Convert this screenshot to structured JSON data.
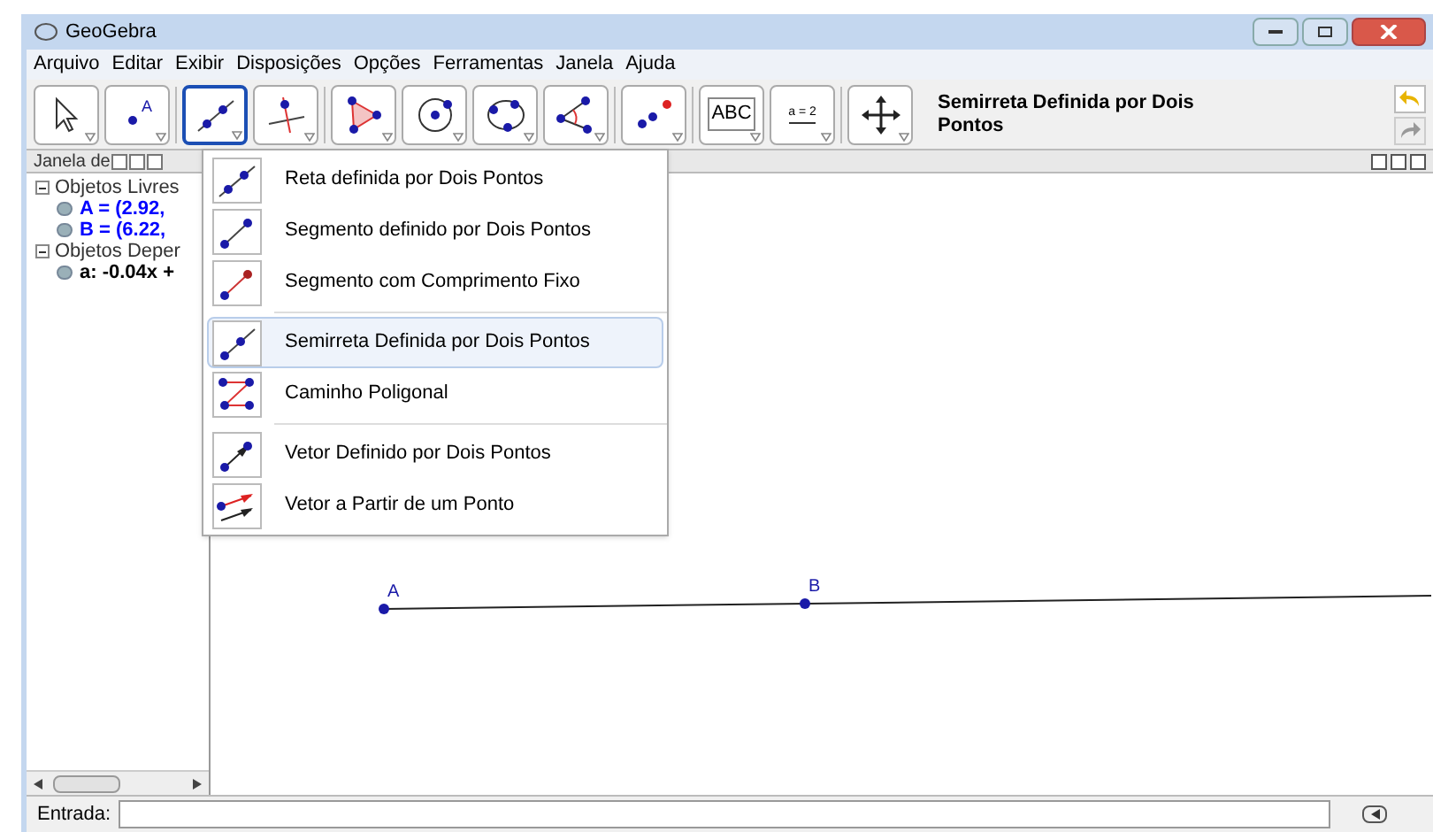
{
  "window": {
    "title": "GeoGebra"
  },
  "menu": [
    "Arquivo",
    "Editar",
    "Exibir",
    "Disposições",
    "Opções",
    "Ferramentas",
    "Janela",
    "Ajuda"
  ],
  "toolbar": {
    "tools": [
      {
        "kind": "move",
        "selected": false
      },
      {
        "kind": "point",
        "label": "A",
        "selected": false
      },
      {
        "kind": "line",
        "selected": true
      },
      {
        "kind": "perpendicular",
        "selected": false
      },
      {
        "kind": "polygon",
        "selected": false
      },
      {
        "kind": "circle",
        "selected": false
      },
      {
        "kind": "circle3",
        "selected": false
      },
      {
        "kind": "angle",
        "selected": false
      },
      {
        "kind": "reflect",
        "selected": false
      },
      {
        "kind": "text",
        "label": "ABC",
        "selected": false
      },
      {
        "kind": "slider",
        "label": "a = 2",
        "selected": false
      },
      {
        "kind": "pan",
        "selected": false
      }
    ],
    "tool_name": "Semirreta Definida por Dois Pontos"
  },
  "dropdown": {
    "groups": [
      {
        "items": [
          {
            "kind": "line",
            "label": "Reta definida por Dois Pontos",
            "highlighted": false
          },
          {
            "kind": "segment",
            "label": "Segmento definido por Dois Pontos",
            "highlighted": false
          },
          {
            "kind": "segment_fixed",
            "label": "Segmento com Comprimento Fixo",
            "highlighted": false
          }
        ]
      },
      {
        "items": [
          {
            "kind": "ray",
            "label": "Semirreta Definida por Dois Pontos",
            "highlighted": true
          },
          {
            "kind": "polyline",
            "label": "Caminho Poligonal",
            "highlighted": false
          }
        ]
      },
      {
        "items": [
          {
            "kind": "vector",
            "label": "Vetor Definido por Dois Pontos",
            "highlighted": false
          },
          {
            "kind": "vector_from_point",
            "label": "Vetor a Partir de um Ponto",
            "highlighted": false
          }
        ]
      }
    ]
  },
  "algebra": {
    "title": "Janela de",
    "tree": [
      {
        "label": "Objetos Livres",
        "expanded": true,
        "children": [
          {
            "label": "A = (2.92,",
            "color": "#0000ff"
          },
          {
            "label": "B = (6.22,",
            "color": "#0000ff"
          }
        ]
      },
      {
        "label": "Objetos Deper",
        "expanded": true,
        "children": [
          {
            "label": "a: -0.04x +",
            "color": "#000000"
          }
        ]
      }
    ]
  },
  "graphics": {
    "points": [
      {
        "label": "A"
      },
      {
        "label": "B"
      }
    ]
  },
  "input_bar": {
    "label": "Entrada:"
  }
}
